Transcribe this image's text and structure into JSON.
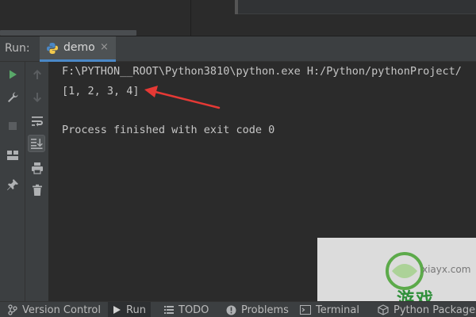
{
  "run_panel": {
    "label": "Run:",
    "tab": {
      "title": "demo",
      "icon": "python-icon",
      "close": "×"
    }
  },
  "left_toolbar": [
    {
      "name": "run-icon",
      "color": "#59a869"
    },
    {
      "name": "wrench-icon"
    },
    {
      "name": "stop-icon"
    },
    {
      "name": "layout-icon"
    },
    {
      "name": "pin-icon"
    }
  ],
  "secondary_toolbar": [
    {
      "name": "up-arrow-icon"
    },
    {
      "name": "down-arrow-icon"
    },
    {
      "name": "soft-wrap-icon"
    },
    {
      "name": "scroll-to-end-icon",
      "active": true
    },
    {
      "name": "print-icon"
    },
    {
      "name": "trash-icon"
    }
  ],
  "console": {
    "command": "F:\\PYTHON__ROOT\\Python3810\\python.exe H:/Python/pythonProject/",
    "output": "[1, 2, 3, 4]",
    "exit_message": "Process finished with exit code 0"
  },
  "annotation": {
    "arrow_color": "#e53935"
  },
  "watermark": {
    "site": "xiayx.com",
    "brand": "游戏"
  },
  "bottom_bar": {
    "items": [
      {
        "label": "Version Control",
        "icon": "branch-icon"
      },
      {
        "label": "Run",
        "icon": "run-icon",
        "active": true
      },
      {
        "label": "TODO",
        "icon": "list-icon"
      },
      {
        "label": "Problems",
        "icon": "info-icon"
      },
      {
        "label": "Terminal",
        "icon": "terminal-icon"
      },
      {
        "label": "Python Packages",
        "icon": "packages-icon"
      }
    ]
  }
}
